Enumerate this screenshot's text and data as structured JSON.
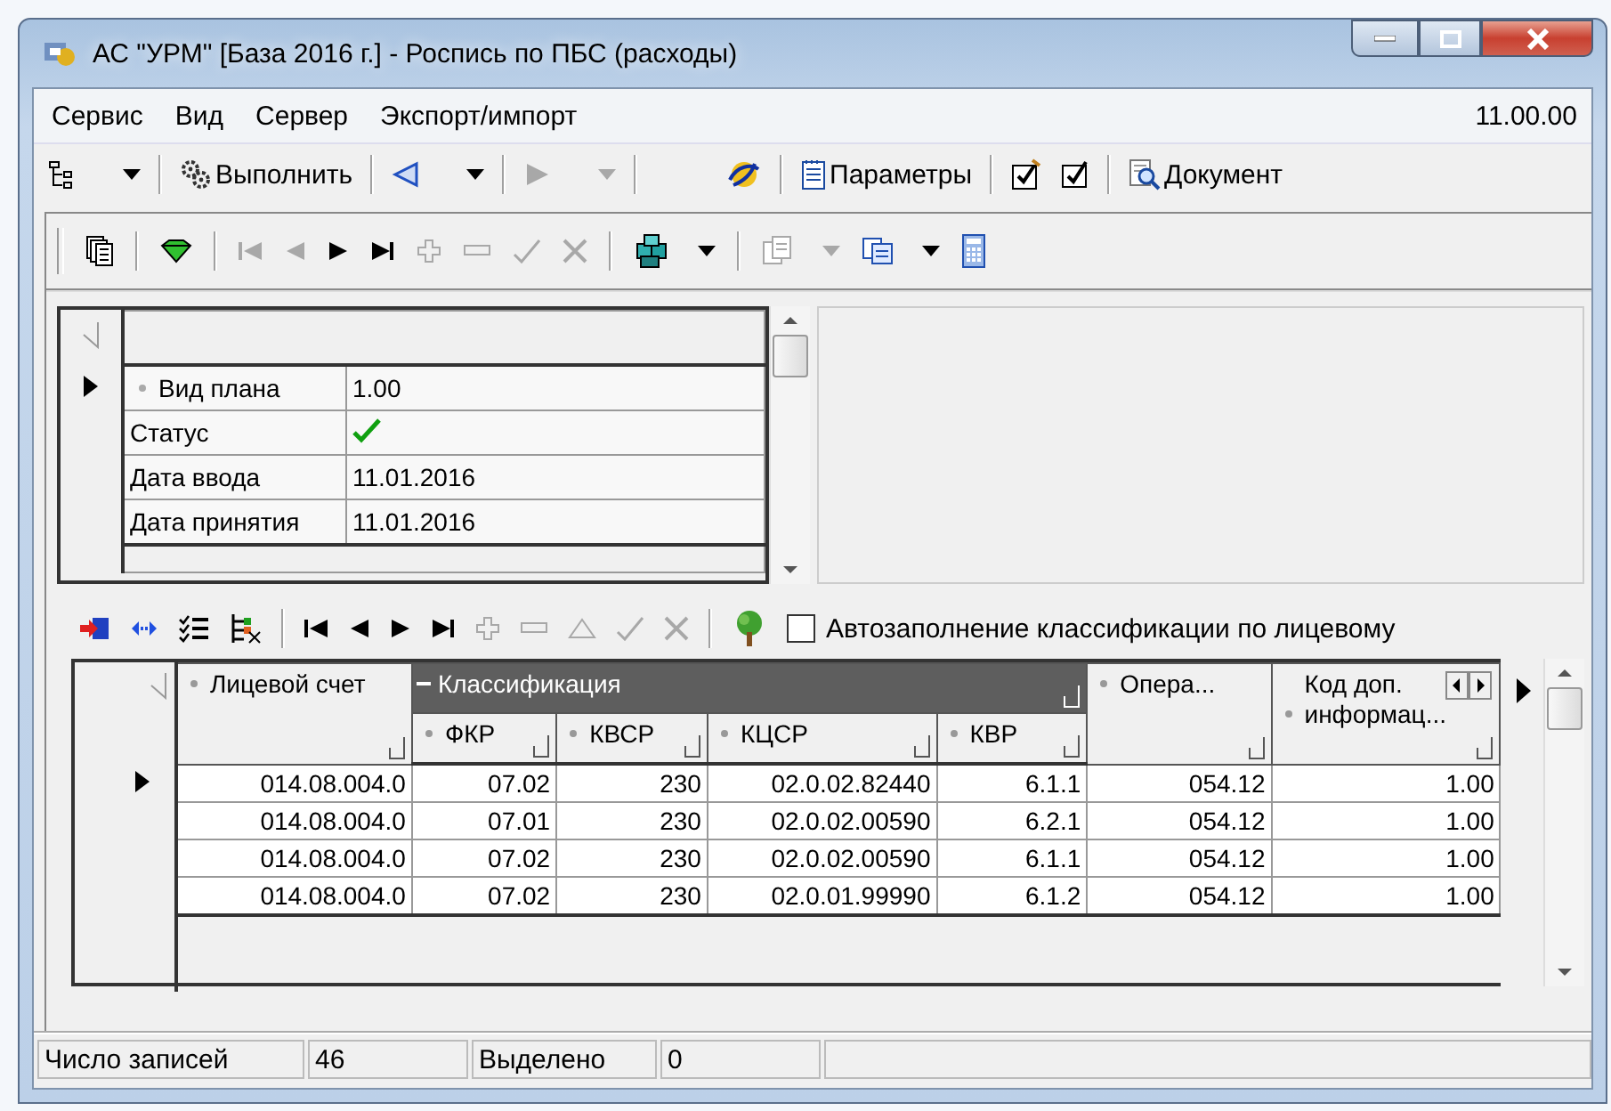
{
  "window": {
    "title": "АС \"УРМ\" [База 2016 г.] - Роспись по ПБС (расходы)"
  },
  "menu": {
    "items": [
      "Сервис",
      "Вид",
      "Сервер",
      "Экспорт/импорт"
    ],
    "version": "11.00.00"
  },
  "main_toolbar": [
    {
      "kind": "tree",
      "disabled": false
    },
    {
      "kind": "caret",
      "disabled": false
    },
    {
      "kind": "separator"
    },
    {
      "kind": "gears",
      "label": "Выполнить",
      "disabled": false
    },
    {
      "kind": "separator"
    },
    {
      "kind": "back",
      "disabled": false
    },
    {
      "kind": "caret",
      "disabled": false
    },
    {
      "kind": "separator"
    },
    {
      "kind": "forward",
      "disabled": true
    },
    {
      "kind": "caret",
      "disabled": true
    },
    {
      "kind": "separator"
    },
    {
      "kind": "globe",
      "disabled": false
    },
    {
      "kind": "separator"
    },
    {
      "kind": "notepad",
      "label": "Параметры",
      "disabled": false
    },
    {
      "kind": "separator"
    },
    {
      "kind": "check-pencil",
      "disabled": false
    },
    {
      "kind": "check",
      "disabled": false
    },
    {
      "kind": "separator"
    },
    {
      "kind": "document",
      "label": "Документ",
      "disabled": false
    }
  ],
  "record_toolbar": [
    {
      "kind": "pages",
      "disabled": false
    },
    {
      "kind": "separator"
    },
    {
      "kind": "gem",
      "disabled": false
    },
    {
      "kind": "separator"
    },
    {
      "kind": "first",
      "disabled": true
    },
    {
      "kind": "prev",
      "disabled": true
    },
    {
      "kind": "next",
      "disabled": false
    },
    {
      "kind": "last",
      "disabled": false
    },
    {
      "kind": "add",
      "disabled": true
    },
    {
      "kind": "remove",
      "disabled": true
    },
    {
      "kind": "confirm",
      "disabled": true
    },
    {
      "kind": "cancel",
      "disabled": true
    },
    {
      "kind": "separator"
    },
    {
      "kind": "cubes",
      "disabled": false
    },
    {
      "kind": "caret",
      "disabled": false
    },
    {
      "kind": "separator"
    },
    {
      "kind": "copy-doc",
      "disabled": true
    },
    {
      "kind": "caret",
      "disabled": true
    },
    {
      "kind": "copy",
      "disabled": false
    },
    {
      "kind": "caret",
      "disabled": false
    },
    {
      "kind": "calculator",
      "disabled": false
    }
  ],
  "plan_form": {
    "rows": [
      {
        "label": "Вид плана",
        "kind": "text",
        "value": "1.00",
        "selected": true,
        "sorted": true
      },
      {
        "label": "Статус",
        "kind": "check",
        "checked": true,
        "selected": false,
        "sorted": false
      },
      {
        "label": "Дата ввода",
        "kind": "text",
        "value": "11.01.2016",
        "selected": false,
        "sorted": false
      },
      {
        "label": "Дата принятия",
        "kind": "text",
        "value": "11.01.2016",
        "selected": false,
        "sorted": false
      }
    ]
  },
  "detail_toolbar": [
    {
      "kind": "exit",
      "disabled": false
    },
    {
      "kind": "swap",
      "disabled": false
    },
    {
      "kind": "checklist",
      "disabled": false
    },
    {
      "kind": "filter",
      "disabled": false
    },
    {
      "kind": "separator"
    },
    {
      "kind": "first",
      "disabled": false
    },
    {
      "kind": "prev",
      "disabled": false
    },
    {
      "kind": "next",
      "disabled": false
    },
    {
      "kind": "last",
      "disabled": false
    },
    {
      "kind": "add",
      "disabled": true
    },
    {
      "kind": "remove",
      "disabled": true
    },
    {
      "kind": "up",
      "disabled": true
    },
    {
      "kind": "confirm",
      "disabled": true
    },
    {
      "kind": "cancel",
      "disabled": true
    },
    {
      "kind": "separator"
    },
    {
      "kind": "plant",
      "disabled": false
    }
  ],
  "autofill": {
    "label": "Автозаполнение классификации по лицевому",
    "checked": false
  },
  "grid": {
    "column_group": {
      "label": "Классификация",
      "expanded": true
    },
    "columns": [
      {
        "label": "Лицевой счет",
        "grouped": false
      },
      {
        "label": "ФКР",
        "grouped": true
      },
      {
        "label": "КВСР",
        "grouped": true
      },
      {
        "label": "КЦСР",
        "grouped": true
      },
      {
        "label": "КВР",
        "grouped": true
      },
      {
        "label": "Опера...",
        "grouped": false
      },
      {
        "label": "Код доп. информац...",
        "grouped": false
      }
    ],
    "rows": [
      {
        "selected": true,
        "cells": [
          "014.08.004.0",
          "07.02",
          "230",
          "02.0.02.82440",
          "6.1.1",
          "054.12",
          "1.00"
        ]
      },
      {
        "selected": false,
        "cells": [
          "014.08.004.0",
          "07.01",
          "230",
          "02.0.02.00590",
          "6.2.1",
          "054.12",
          "1.00"
        ]
      },
      {
        "selected": false,
        "cells": [
          "014.08.004.0",
          "07.02",
          "230",
          "02.0.02.00590",
          "6.1.1",
          "054.12",
          "1.00"
        ]
      },
      {
        "selected": false,
        "cells": [
          "014.08.004.0",
          "07.02",
          "230",
          "02.0.01.99990",
          "6.1.2",
          "054.12",
          "1.00"
        ]
      }
    ]
  },
  "status_bar": [
    {
      "label": "Число записей",
      "value": "46"
    },
    {
      "label": "Выделено",
      "value": "0"
    }
  ]
}
